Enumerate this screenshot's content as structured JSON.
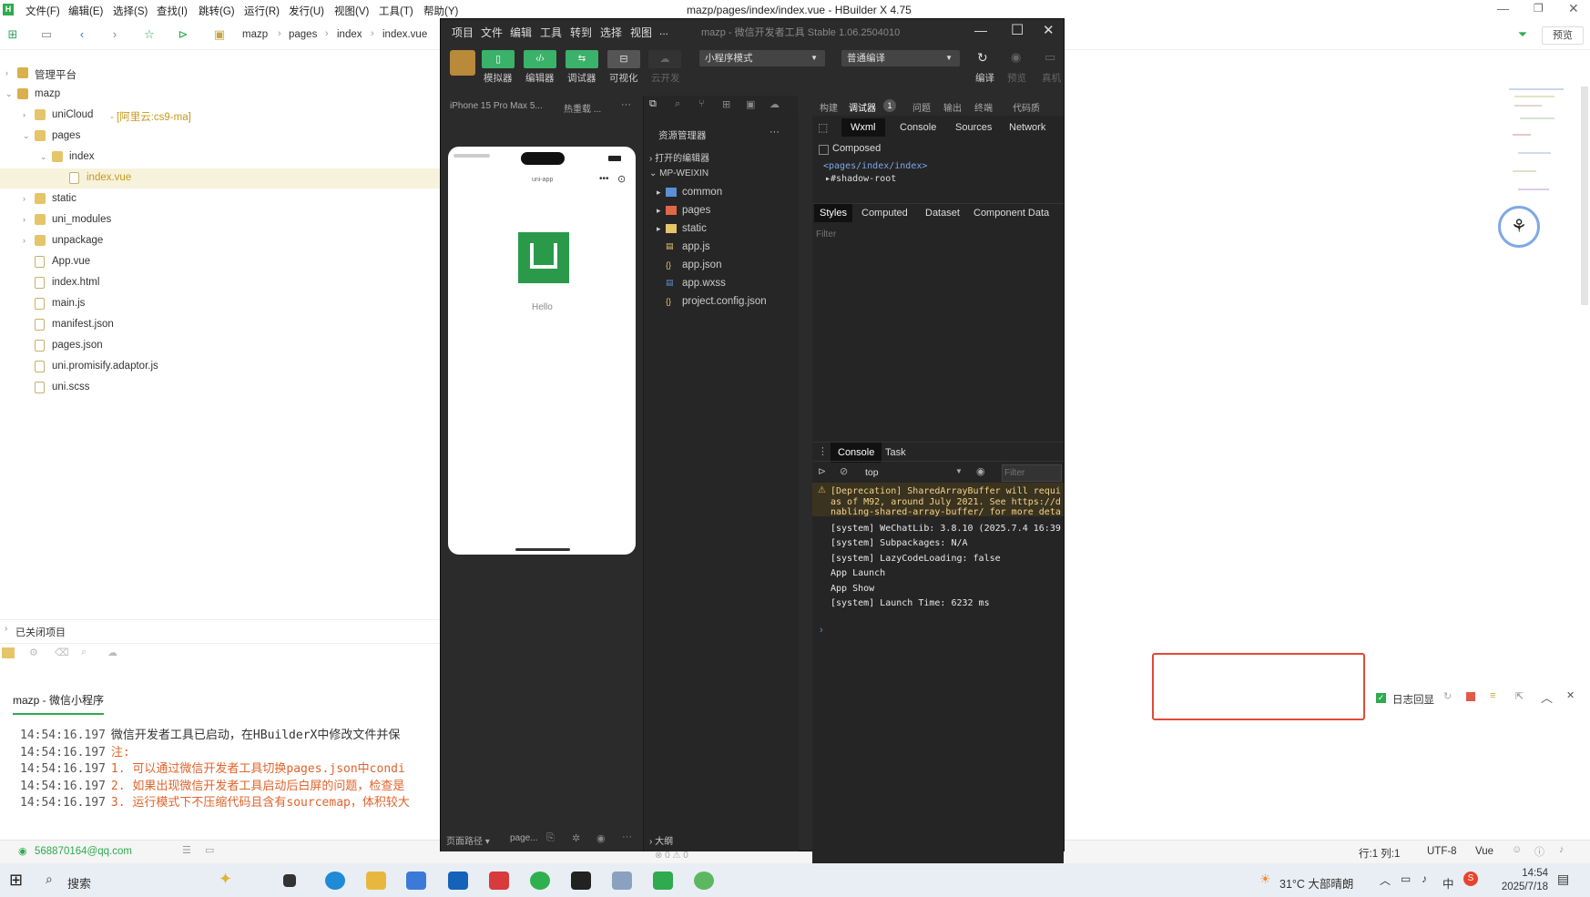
{
  "hbuilder": {
    "menu": [
      "文件(F)",
      "编辑(E)",
      "选择(S)",
      "查找(I)",
      "跳转(G)",
      "运行(R)",
      "发行(U)",
      "视图(V)",
      "工具(T)",
      "帮助(Y)"
    ],
    "title": "mazp/pages/index/index.vue - HBuilder X 4.75",
    "breadcrumb": [
      "mazp",
      "pages",
      "index",
      "index.vue"
    ],
    "preview_button": "预览",
    "tree": [
      {
        "label": "管理平台",
        "indent": 0,
        "arrow": "›",
        "type": "project"
      },
      {
        "label": "mazp",
        "indent": 0,
        "arrow": "⌄",
        "type": "project"
      },
      {
        "label": "uniCloud",
        "suffix": " - [阿里云:cs9-ma]",
        "indent": 1,
        "arrow": "›",
        "type": "folder"
      },
      {
        "label": "pages",
        "indent": 1,
        "arrow": "⌄",
        "type": "folder"
      },
      {
        "label": "index",
        "indent": 2,
        "arrow": "⌄",
        "type": "folder"
      },
      {
        "label": "index.vue",
        "indent": 3,
        "arrow": "",
        "type": "file",
        "selected": true
      },
      {
        "label": "static",
        "indent": 1,
        "arrow": "›",
        "type": "folder"
      },
      {
        "label": "uni_modules",
        "indent": 1,
        "arrow": "›",
        "type": "folder"
      },
      {
        "label": "unpackage",
        "indent": 1,
        "arrow": "›",
        "type": "folder"
      },
      {
        "label": "App.vue",
        "indent": 1,
        "arrow": "",
        "type": "file"
      },
      {
        "label": "index.html",
        "indent": 1,
        "arrow": "",
        "type": "file"
      },
      {
        "label": "main.js",
        "indent": 1,
        "arrow": "",
        "type": "file"
      },
      {
        "label": "manifest.json",
        "indent": 1,
        "arrow": "",
        "type": "file"
      },
      {
        "label": "pages.json",
        "indent": 1,
        "arrow": "",
        "type": "file"
      },
      {
        "label": "uni.promisify.adaptor.js",
        "indent": 1,
        "arrow": "",
        "type": "file"
      },
      {
        "label": "uni.scss",
        "indent": 1,
        "arrow": "",
        "type": "file"
      }
    ],
    "closed_projects": "已关闭项目",
    "console_tab": "mazp - 微信小程序",
    "logs": [
      {
        "time": "14:54:16.197",
        "text": "微信开发者工具已启动，在HBuilderX中修改文件并保",
        "color": "#333"
      },
      {
        "time": "14:54:16.197",
        "text": "注:",
        "color": "#e0632b"
      },
      {
        "time": "14:54:16.197",
        "text": "1. 可以通过微信开发者工具切换pages.json中condi",
        "color": "#e0632b"
      },
      {
        "time": "14:54:16.197",
        "text": "2. 如果出现微信开发者工具启动后白屏的问题，检查是",
        "color": "#e0632b"
      },
      {
        "time": "14:54:16.197",
        "text": "3. 运行模式下不压缩代码且含有sourcemap，体积较大",
        "color": "#e0632b"
      }
    ],
    "log_echo_label": "日志回显",
    "status": {
      "user": "568870164@qq.com",
      "pos": "行:1  列:1",
      "encoding": "UTF-8",
      "lang": "Vue"
    }
  },
  "wechat": {
    "menu": [
      "项目",
      "文件",
      "编辑",
      "工具",
      "转到",
      "选择",
      "视图",
      "..."
    ],
    "title": "mazp - 微信开发者工具 Stable 1.06.2504010",
    "tools": [
      "模拟器",
      "编辑器",
      "调试器",
      "可视化",
      "云开发"
    ],
    "mode": "小程序模式",
    "compile_mode": "普通编译",
    "compile_btns": [
      "编译",
      "预览",
      "真机"
    ],
    "device": "iPhone 15 Pro Max 5...",
    "hot_reload": "热重载 ...",
    "phone_nav_title": "uni-app",
    "phone_hello": "Hello",
    "explorer_title": "资源管理器",
    "open_editors": "打开的编辑器",
    "root": "MP-WEIXIN",
    "files": [
      {
        "label": "common",
        "kind": "folder",
        "color": "#5b8fd6"
      },
      {
        "label": "pages",
        "kind": "folder",
        "color": "#e06848"
      },
      {
        "label": "static",
        "kind": "folder",
        "color": "#e5c46a"
      },
      {
        "label": "app.js",
        "kind": "js",
        "color": "#e5c46a"
      },
      {
        "label": "app.json",
        "kind": "json",
        "color": "#e5c46a"
      },
      {
        "label": "app.wxss",
        "kind": "wxss",
        "color": "#5b8fd6"
      },
      {
        "label": "project.config.json",
        "kind": "json",
        "color": "#e5c46a"
      }
    ],
    "outline": "大纲",
    "bottom_left": [
      "页面路径 ▾",
      "page..."
    ],
    "errors": "⊗ 0 ⚠ 0",
    "debug_tabs": [
      "构建",
      "调试器",
      "问题",
      "输出",
      "终端",
      "代码质"
    ],
    "debug_badge": "1",
    "panel_tabs": [
      "Wxml",
      "Console",
      "Sources",
      "Network"
    ],
    "composed": "Composed",
    "wxml_lines": [
      "<pages/index/index>",
      "▸#shadow-root"
    ],
    "style_tabs": [
      "Styles",
      "Computed",
      "Dataset",
      "Component Data"
    ],
    "filter": "Filter",
    "console_tabs": [
      "Console",
      "Task"
    ],
    "context": "top",
    "console_lines": [
      {
        "text": "[Deprecation] SharedArrayBuffer will requi",
        "warn": true
      },
      {
        "text": "as of M92, around July 2021. See https://d",
        "warn": true
      },
      {
        "text": "nabling-shared-array-buffer/ for more deta",
        "warn": true
      },
      {
        "text": "[system] WeChatLib: 3.8.10 (2025.7.4 16:39",
        "warn": false
      },
      {
        "text": "[system] Subpackages: N/A",
        "warn": false
      },
      {
        "text": "[system] LazyCodeLoading: false",
        "warn": false
      },
      {
        "text": "App Launch",
        "warn": false
      },
      {
        "text": "App Show",
        "warn": false
      },
      {
        "text": "[system] Launch Time: 6232 ms",
        "warn": false
      }
    ]
  },
  "taskbar": {
    "search": "搜索",
    "weather": "31°C 大部晴朗",
    "ime": "中",
    "time": "14:54",
    "date": "2025/7/18"
  }
}
